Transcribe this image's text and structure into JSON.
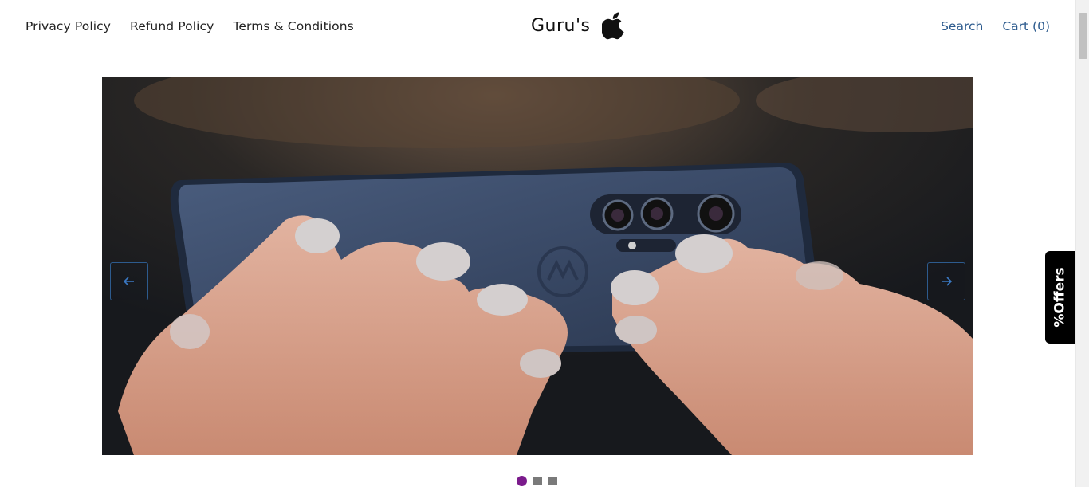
{
  "header": {
    "nav_left": [
      {
        "label": "Privacy Policy"
      },
      {
        "label": "Refund Policy"
      },
      {
        "label": "Terms & Conditions"
      }
    ],
    "brand_name": "Guru's",
    "brand_logo_icon": "apple-icon",
    "nav_right": [
      {
        "label": "Search"
      },
      {
        "label": "Cart (0)"
      }
    ]
  },
  "slider": {
    "slide_icon": "phone-in-hands-photo",
    "prev_icon": "arrow-left-icon",
    "next_icon": "arrow-right-icon",
    "dots_total": 3,
    "active_dot": 1
  },
  "offers_tab": {
    "label": "%Offers"
  },
  "colors": {
    "link": "#2d5b8e",
    "active_dot": "#7b1b8c",
    "inactive_dot": "#7a7a7a",
    "offers_bg": "#000000"
  }
}
